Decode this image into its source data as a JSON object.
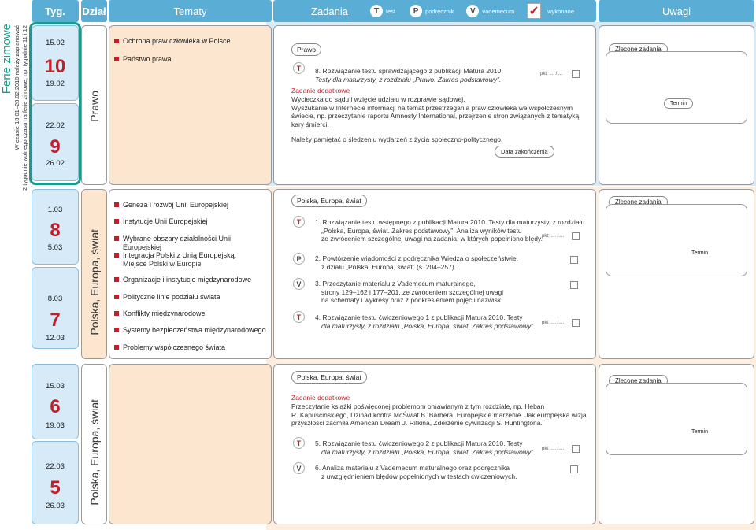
{
  "header": {
    "tyg": "Tyg.",
    "dzial": "Dział",
    "tematy": "Tematy",
    "zadania": "Zadania",
    "uwagi": "Uwagi",
    "legend": [
      {
        "icon": "T",
        "label": "test"
      },
      {
        "icon": "P",
        "label": "podręcznik"
      },
      {
        "icon": "V",
        "label": "vademecum"
      }
    ],
    "done_mark": "✓",
    "done_label": "wykonane"
  },
  "side": {
    "title": "Ferie zimowe",
    "line1": "W czasie 18.01–28.02.2010 należy zaplanować",
    "line2": "2 tygodnie wolnego czasu na ferie zimowe, np. tygodnie 11 i 12"
  },
  "colors": {
    "accent": "#5aaed6",
    "red": "#c0202a",
    "teal": "#1a9a8a"
  },
  "blocks": [
    {
      "dates": [
        {
          "start": "15.02",
          "week": "10",
          "end": "19.02"
        },
        {
          "start": "22.02",
          "week": "9",
          "end": "26.02"
        }
      ],
      "dzial": "Prawo",
      "topics": [
        "Ochrona praw człowieka w Polsce",
        "Państwo prawa"
      ],
      "tag": "Prawo",
      "tasks": [
        {
          "icon": "T",
          "text1": "8. Rozwiązanie testu sprawdzającego z publikacji Matura 2010.",
          "text2": "Testy dla maturzysty, z rozdziału „Prawo. Zakres podstawowy”."
        }
      ],
      "extra_title": "Zadanie dodatkowe",
      "extra_lines": [
        "Wycieczka do sądu i wzięcie udziału w rozprawie sądowej.",
        "Wyszukanie w Internecie informacji na temat przestrzegania praw człowieka we współczesnym",
        "świecie, np. przeczytanie raportu Amnesty International, przejrzenie stron związanych z tematyką",
        "kary śmierci."
      ],
      "note": "Należy pamiętać o śledzeniu wydarzeń z życia społeczno-politycznego.",
      "deadline": "Data zakończenia",
      "zlecone": "Zlecone zadania",
      "termin": "Termin"
    },
    {
      "dates": [
        {
          "start": "1.03",
          "week": "8",
          "end": "5.03"
        },
        {
          "start": "8.03",
          "week": "7",
          "end": "12.03"
        }
      ],
      "dzial": "Polska, Europa, świat",
      "topics": [
        "Geneza i rozwój Unii Europejskiej",
        "Instytucje Unii Europejskiej",
        "Wybrane obszary działalności Unii Europejskiej",
        "Integracja Polski z Unią Europejską.",
        "Miejsce Polski w Europie",
        "Organizacje i instytucje międzynarodowe",
        "Polityczne linie podziału świata",
        "Konflikty międzynarodowe",
        "Systemy bezpieczeństwa międzynarodowego",
        "Problemy współczesnego świata"
      ],
      "tag": "Polska, Europa, świat",
      "tasks": [
        {
          "icon": "T",
          "text1": "1. Rozwiązanie testu wstępnego z publikacji Matura 2010. Testy dla maturzysty, z rozdziału",
          "text2": "„Polska, Europa, świat. Zakres podstawowy”. Analiza wyników testu",
          "text3": "ze zwróceniem szczególnej uwagi na zadania, w których popełniono błędy."
        },
        {
          "icon": "P",
          "text1": "2. Powtórzenie wiadomości z podręcznika Wiedza o społeczeństwie,",
          "text2": "z działu „Polska, Europa, świat” (s. 204–257)."
        },
        {
          "icon": "V",
          "text1": "3. Przeczytanie materiału z Vademecum maturalnego,",
          "text2": "strony 129–162 i 177–201, ze zwróceniem szczególnej uwagi",
          "text3": "na schematy i wykresy oraz z podkreśleniem pojęć i nazwisk."
        },
        {
          "icon": "T",
          "text1": "4. Rozwiązanie testu ćwiczeniowego 1 z publikacji Matura 2010. Testy",
          "text2": "dla maturzysty, z rozdziału „Polska, Europa, świat. Zakres podstawowy”."
        }
      ],
      "zlecone": "Zlecone zadania",
      "termin": "Termin"
    },
    {
      "dates": [
        {
          "start": "15.03",
          "week": "6",
          "end": "19.03"
        },
        {
          "start": "22.03",
          "week": "5",
          "end": "26.03"
        }
      ],
      "dzial": "Polska, Europa, świat",
      "tag": "Polska, Europa, świat",
      "extra_title": "Zadanie dodatkowe",
      "extra_lines": [
        "Przeczytanie książki poświęconej problemom omawianym z tym rozdziale, np. Heban",
        "R. Kapuścińskiego, Dżihad kontra McŚwiat B. Barbera, Europejskie marzenie. Jak europejska wizja",
        "przyszłości zaćmiła American Dream J. Rifkina, Zderzenie cywilizacji S. Huntingtona."
      ],
      "tasks": [
        {
          "icon": "T",
          "text1": "5. Rozwiązanie testu ćwiczeniowego 2 z publikacji Matura 2010. Testy",
          "text2": "dla maturzysty, z rozdziału „Polska, Europa, świat. Zakres podstawowy”."
        },
        {
          "icon": "V",
          "text1": "6. Analiza materiału z Vademecum maturalnego oraz podręcznika",
          "text2": "z uwzględnieniem błędów popełnionych w testach ćwiczeniowych."
        }
      ],
      "zlecone": "Zlecone zadania",
      "termin": "Termin"
    }
  ],
  "pkt": "pkt: .... /....",
  "pkt_short": "pkt: .... /...."
}
